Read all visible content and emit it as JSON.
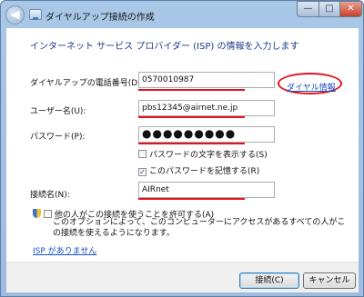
{
  "window": {
    "title": "ダイヤルアップ接続の作成",
    "controls": {
      "minimize": "—",
      "maximize": "□",
      "close": "✕"
    },
    "back_glyph": "◀"
  },
  "heading": "インターネット サービス プロバイダー (ISP) の情報を入力します",
  "form": {
    "phone": {
      "label": "ダイヤルアップの電話番号(D):",
      "value": "0570010987"
    },
    "user": {
      "label": "ユーザー名(U):",
      "value": "pbs12345@airnet.ne.jp"
    },
    "password": {
      "label": "パスワード(P):",
      "value": "●●●●●●●●●"
    },
    "show_password": {
      "label": "パスワードの文字を表示する(S)",
      "checked": false
    },
    "remember_password": {
      "label": "このパスワードを記憶する(R)",
      "checked": true,
      "mark": "✓"
    },
    "connection_name": {
      "label": "接続名(N):",
      "value": "AIRnet"
    },
    "allow_others": {
      "label": "他の人がこの接続を使うことを許可する(A)",
      "description": "このオプションによって、このコンピューターにアクセスがあるすべての人がこの接続を使えるようになります。",
      "checked": false
    }
  },
  "links": {
    "dial_info": "ダイヤル情報",
    "no_isp": "ISP がありません"
  },
  "buttons": {
    "connect": "接続(C)",
    "cancel": "キャンセル"
  },
  "colors": {
    "annotation_red": "#e0141c",
    "link_blue": "#1a4fbf",
    "heading_blue": "#1e3a8a"
  },
  "icons": {
    "back": "back-arrow-icon",
    "app": "dialup-connection-icon",
    "shield": "uac-shield-icon"
  }
}
